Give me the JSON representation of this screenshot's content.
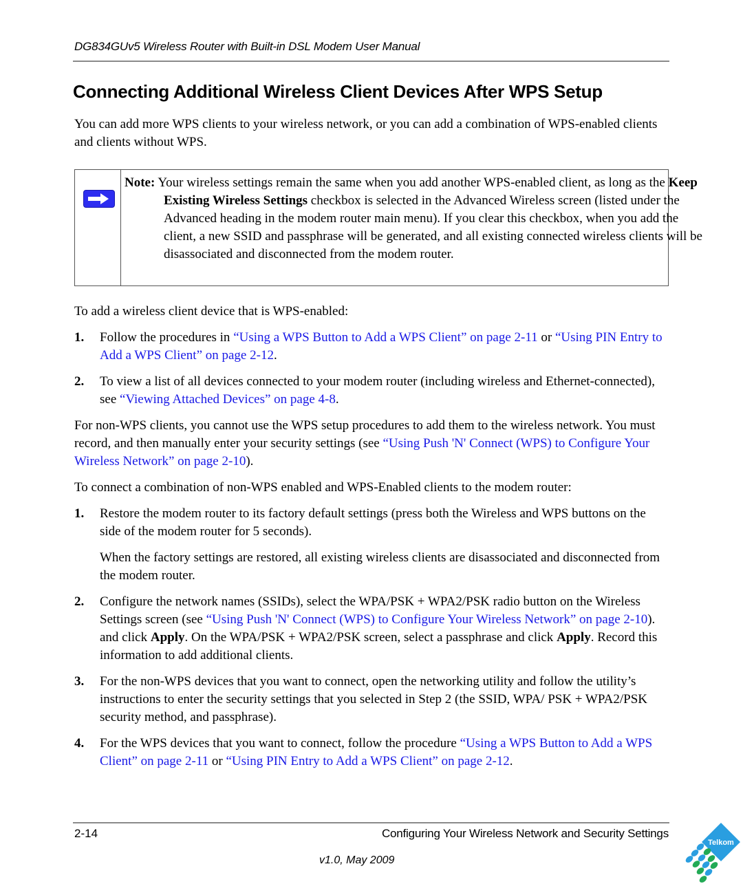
{
  "header": {
    "running_title": "DG834GUv5 Wireless Router with Built-in DSL Modem User Manual"
  },
  "section": {
    "title": "Connecting Additional Wireless Client Devices After WPS Setup",
    "intro": "You can add more WPS clients to your wireless network, or you can add a combination of WPS-enabled clients and clients without WPS."
  },
  "note": {
    "icon": "arrow-right-icon",
    "label": "Note:",
    "text_before": " Your wireless settings remain the same when you add another WPS-enabled client, as long as the ",
    "bold": "Keep Existing Wireless Settings",
    "text_after": " checkbox is selected in the Advanced Wireless screen (listed under the Advanced heading in the modem router main menu). If you clear this checkbox, when you add the client, a new SSID and passphrase will be generated, and all existing connected wireless clients will be disassociated and disconnected from the modem router."
  },
  "wps_enabled": {
    "lead": "To add a wireless client device that is WPS-enabled:",
    "steps": [
      {
        "num": "1.",
        "t1": "Follow the procedures in ",
        "link1": "“Using a WPS Button to Add a WPS Client” on page 2-11",
        "t2": " or ",
        "link2": "“Using PIN Entry to Add a WPS Client” on page 2-12",
        "t3": "."
      },
      {
        "num": "2.",
        "t1": "To view a list of all devices connected to your modem router (including wireless and Ethernet-connected), see ",
        "link1": "“Viewing Attached Devices” on page 4-8",
        "t2": "."
      }
    ]
  },
  "non_wps": {
    "t1": "For non-WPS clients, you cannot use the WPS setup procedures to add them to the wireless network. You must record, and then manually enter your security settings (see ",
    "link1": "“Using Push 'N' Connect (WPS) to Configure Your Wireless Network” on page 2-10",
    "t2": ")."
  },
  "combination": {
    "lead": "To connect a combination of non-WPS enabled and WPS-Enabled clients to the modem router:",
    "steps": [
      {
        "num": "1.",
        "text": "Restore the modem router to its factory default settings (press both the Wireless and WPS buttons on the side of the modem router for 5 seconds).",
        "followup": "When the factory settings are restored, all existing wireless clients are disassociated and disconnected from the modem router."
      },
      {
        "num": "2.",
        "t1": "Configure the network names (SSIDs), select the WPA/PSK + WPA2/PSK radio button on the Wireless Settings screen (see ",
        "link1": "“Using Push 'N' Connect (WPS) to Configure Your Wireless Network” on page 2-10",
        "t2": "). and click ",
        "b1": "Apply",
        "t3": ". On the WPA/PSK + WPA2/PSK screen, select a passphrase and click ",
        "b2": "Apply",
        "t4": ". Record this information to add additional clients."
      },
      {
        "num": "3.",
        "text": "For the non-WPS devices that you want to connect, open the networking utility and follow the utility’s instructions to enter the security settings that you selected in Step 2 (the SSID, WPA/ PSK + WPA2/PSK security method, and passphrase)."
      },
      {
        "num": "4.",
        "t1": "For the WPS devices that you want to connect, follow the procedure ",
        "link1": "“Using a WPS Button to Add a WPS Client” on page 2-11",
        "t2": " or ",
        "link2": "“Using PIN Entry to Add a WPS Client” on page 2-12",
        "t3": "."
      }
    ]
  },
  "footer": {
    "page_number": "2-14",
    "chapter_title": "Configuring Your Wireless Network and Security Settings",
    "version": "v1.0, May 2009",
    "logo_text": "Telkom"
  },
  "colors": {
    "link": "#1a1ae6",
    "note_icon": "#2d2df0",
    "rule": "#8a8a8a",
    "logo_blue": "#2a9ee0",
    "logo_green": "#22aa55"
  }
}
